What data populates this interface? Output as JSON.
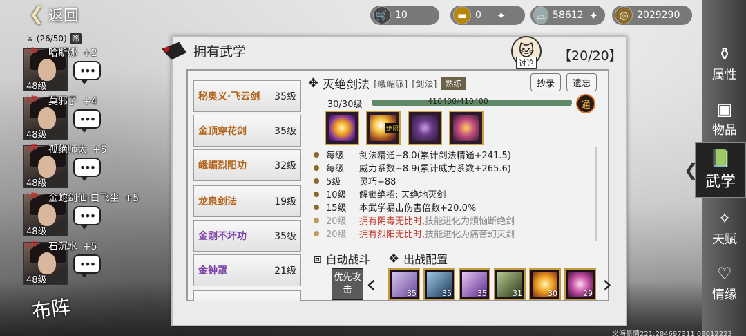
{
  "header": {
    "back_label": "返回"
  },
  "resources": [
    {
      "icon": "cart-icon",
      "value": "10",
      "plus": false
    },
    {
      "icon": "gold-bar-icon",
      "value": "0",
      "plus": true
    },
    {
      "icon": "silver-ingot-icon",
      "value": "58612",
      "plus": true
    },
    {
      "icon": "coin-icon",
      "value": "2029290",
      "plus": false
    }
  ],
  "roster": {
    "capacity": "(26/50)",
    "tag": "筛",
    "badge": "上阵",
    "heroes": [
      {
        "name": "哈斯娜",
        "bonus": "+2",
        "level": "48级"
      },
      {
        "name": "莫邪子",
        "bonus": "+4",
        "level": "48级"
      },
      {
        "name": "孤绝师太",
        "bonus": "+5",
        "level": "48级"
      },
      {
        "name": "金蛇剑仙·白飞尘",
        "bonus": "+5",
        "level": "48级"
      },
      {
        "name": "石沉水",
        "bonus": "+5",
        "level": "48级"
      }
    ],
    "chat_glyph": "•••",
    "formation_label": "布阵"
  },
  "panel": {
    "title": "拥有武学",
    "count": "20/20",
    "discuss_label": "讨论"
  },
  "skills": [
    {
      "name": "秘奥义·飞云剑",
      "level": "35级",
      "color": "#b4641a"
    },
    {
      "name": "金顶穿花剑",
      "level": "35级",
      "color": "#b4641a"
    },
    {
      "name": "峨嵋烈阳功",
      "level": "32级",
      "color": "#b4641a"
    },
    {
      "name": "龙泉剑法",
      "level": "19级",
      "color": "#b4641a"
    },
    {
      "name": "金刚不坏功",
      "level": "35级",
      "color": "#7b3fa8"
    },
    {
      "name": "金钟罩",
      "level": "21级",
      "color": "#7b3fa8"
    }
  ],
  "detail": {
    "name": "灭绝剑法",
    "school": "[峨嵋派]",
    "type": "[剑法]",
    "proficiency": "熟练",
    "copy_label": "抄录",
    "legacy_label": "遗忘",
    "level": "30/30级",
    "exp_text": "410400/410400",
    "exp_ratio": 1,
    "tong_label": "通",
    "move_tag": "绝招",
    "effects": [
      {
        "lvl": "每级",
        "text": "剑法精通+8.0(累计剑法精通+241.5)",
        "style": "normal"
      },
      {
        "lvl": "每级",
        "text": "威力系数+8.9(累计威力系数+265.6)",
        "style": "normal"
      },
      {
        "lvl": "5级",
        "text": "灵巧+88",
        "style": "normal"
      },
      {
        "lvl": "10级",
        "text": "解锁绝招:  天绝地灭剑",
        "style": "normal"
      },
      {
        "lvl": "15级",
        "text": "本武学暴击伤害倍数+20.0%",
        "style": "normal"
      },
      {
        "lvl": "20级",
        "red": "拥有阴毒无比时,",
        "gray": "技能进化为烦恼断绝剑",
        "style": "red"
      },
      {
        "lvl": "20级",
        "red": "拥有烈阳无比时,",
        "gray": "技能进化为痛苦幻灭剑",
        "style": "red"
      }
    ]
  },
  "battle": {
    "auto_label": "自动战斗",
    "config_label": "出战配置",
    "priority_label": "优先攻击",
    "slots": [
      {
        "num": "35",
        "color": "#8a6fb0"
      },
      {
        "num": "35",
        "color": "#3a6d9a"
      },
      {
        "num": "35",
        "color": "#7a5aa8"
      },
      {
        "num": "31",
        "color": "#4a5a38"
      },
      {
        "num": "30",
        "color": "#e0a030"
      },
      {
        "num": "29",
        "color": "#c04aa0"
      }
    ]
  },
  "nav": [
    {
      "icon": "gourd-icon",
      "label": "属性",
      "active": false
    },
    {
      "icon": "box-icon",
      "label": "物品",
      "active": false
    },
    {
      "icon": "book-icon",
      "label": "武学",
      "active": true
    },
    {
      "icon": "talent-icon",
      "label": "天赋",
      "active": false
    },
    {
      "icon": "heart-icon",
      "label": "情缘",
      "active": false
    }
  ],
  "footer": "义海豪情221:284697311 08012223"
}
